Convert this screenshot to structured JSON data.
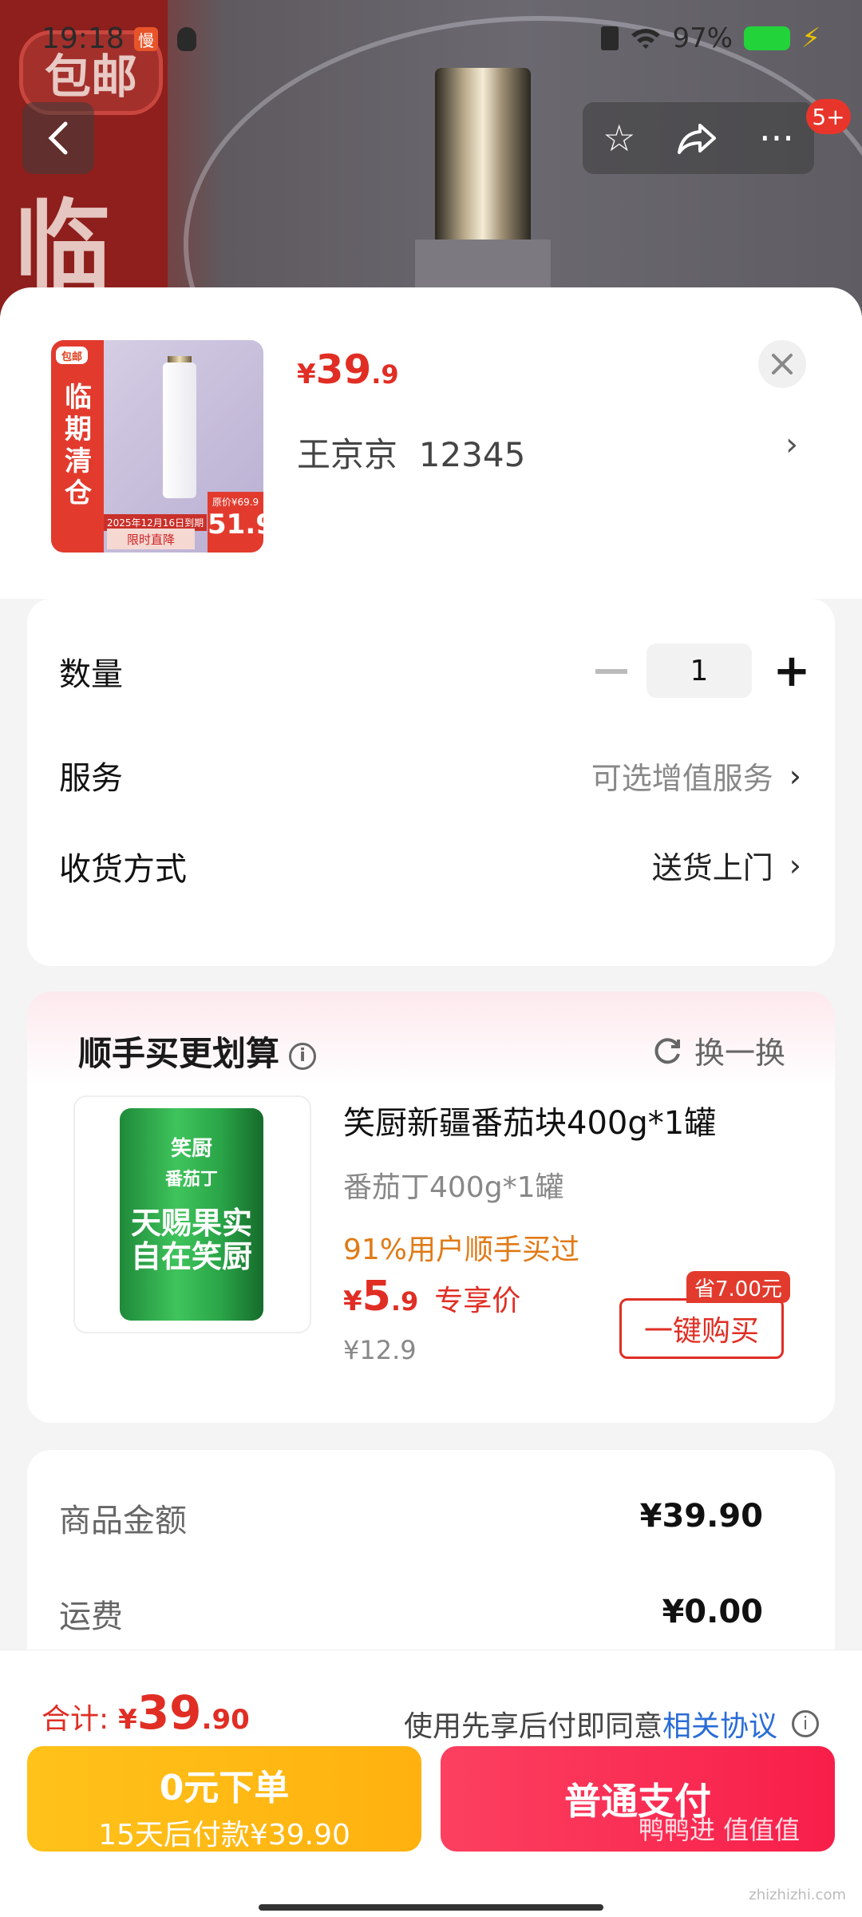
{
  "status_bar": {
    "time": "19:18",
    "app_icon_text": "慢",
    "battery": "97%"
  },
  "background": {
    "badge": "包邮",
    "big_char": "临",
    "notification_badge": "5+"
  },
  "product": {
    "price_currency": "¥",
    "price_int": "39",
    "price_dec": ".9",
    "address_name": "王京京",
    "address_phone": "12345",
    "thumb": {
      "tag": "包邮",
      "vertical_text": "临期清仓",
      "date": "2025年12月16日到期",
      "button": "限时直降",
      "orig_price": "原价¥69.9",
      "deal_price": "51.9"
    }
  },
  "options": {
    "quantity_label": "数量",
    "quantity_value": "1",
    "service_label": "服务",
    "service_value": "可选增值服务",
    "delivery_label": "收货方式",
    "delivery_value": "送货上门"
  },
  "upsell": {
    "title": "顺手买更划算",
    "swap_label": "换一换",
    "item_name": "笑厨新疆番茄块400g*1罐",
    "item_spec": "番茄丁400g*1罐",
    "bought_text": "91%用户顺手买过",
    "price_currency": "¥",
    "price_int": "5",
    "price_dec": ".9",
    "price_label": "专享价",
    "orig_price": "¥12.9",
    "save_badge": "省7.00元",
    "buy_button": "一键购买",
    "can": {
      "logo": "笑厨",
      "sub": "番茄丁",
      "big": "天赐果实 自在笑厨"
    }
  },
  "summary": {
    "goods_label": "商品金额",
    "goods_value": "¥39.90",
    "shipping_label": "运费",
    "shipping_value": "¥0.00"
  },
  "footer": {
    "total_label": "合计:",
    "total_currency": "¥",
    "total_int": "39",
    "total_dec": ".90",
    "agree_text": "使用先享后付即同意",
    "agree_link": "相关协议",
    "btn_zero_line1": "0元下单",
    "btn_zero_line2": "15天后付款¥39.90",
    "btn_pay": "普通支付",
    "watermark": "鸭鸭进 值值值",
    "watermark_url": "zhizhizhi.com"
  },
  "colors": {
    "accent": "#e02e24",
    "pay": "#f81e4a",
    "zero": "#ffb10f",
    "link": "#2a6cd6"
  }
}
